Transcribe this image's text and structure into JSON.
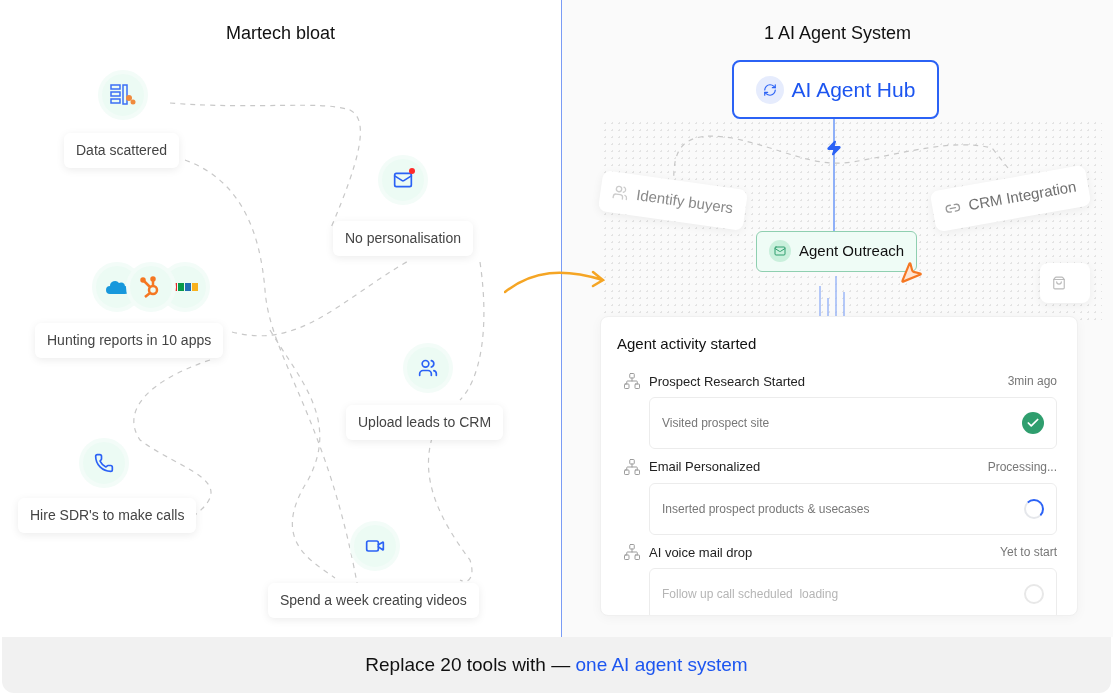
{
  "left_panel": {
    "title": "Martech bloat",
    "items": [
      {
        "label": "Data scattered",
        "kind": "data"
      },
      {
        "label": "No personalisation",
        "kind": "mail"
      },
      {
        "label": "Hunting reports in 10 apps",
        "kind": "apps"
      },
      {
        "label": "Upload leads to CRM",
        "kind": "team"
      },
      {
        "label": "Hire SDR's to make calls",
        "kind": "phone"
      },
      {
        "label": "Spend a week creating videos",
        "kind": "video"
      }
    ]
  },
  "right_panel": {
    "title": "1 AI Agent System",
    "hub": {
      "label": "AI Agent Hub"
    },
    "side_nodes": [
      {
        "label": "Identify buyers",
        "kind": "buyers"
      },
      {
        "label": "CRM Integration",
        "kind": "crm"
      }
    ],
    "active_node": {
      "label": "Agent Outreach"
    },
    "activity": {
      "title": "Agent activity started",
      "steps": [
        {
          "title": "Prospect Research Started",
          "status_text": "3min ago",
          "detail": "Visited prospect site",
          "kind": "done"
        },
        {
          "title": "Email Personalized",
          "status_text": "Processing...",
          "detail": "Inserted prospect products & usecases",
          "kind": "processing"
        },
        {
          "title": "AI voice mail drop",
          "status_text": "Yet to start",
          "detail": "Follow up call scheduled  loading",
          "kind": "pending"
        }
      ]
    }
  },
  "footer": {
    "text": "Replace 20 tools with — ",
    "link": "one AI agent system"
  }
}
